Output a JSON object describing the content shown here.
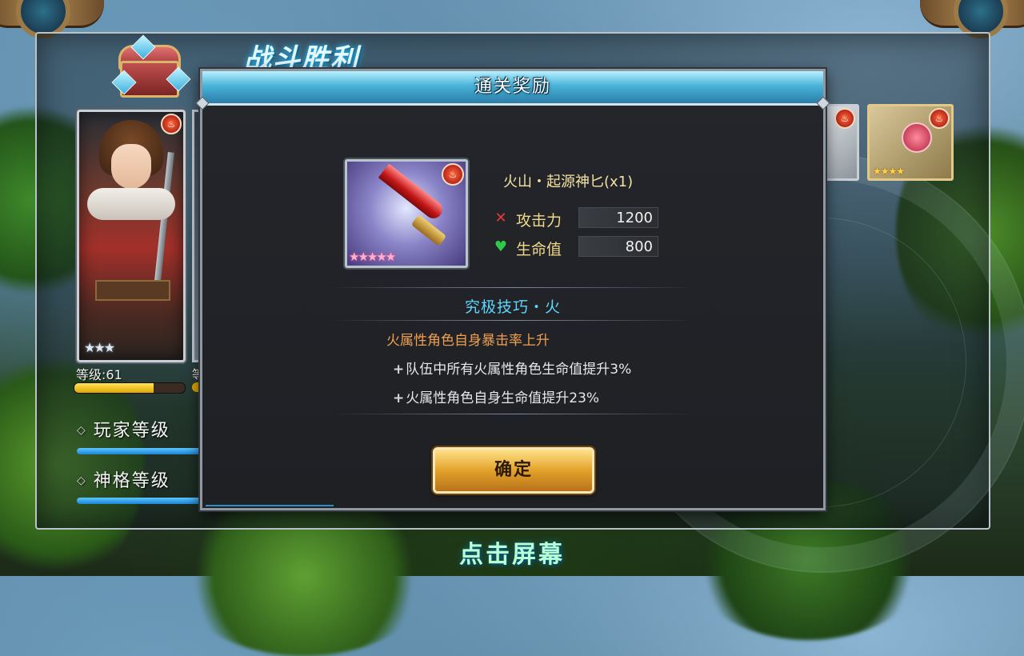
{
  "battle": {
    "title": "战斗胜利",
    "tap_hint": "点击屏幕"
  },
  "hero": {
    "level_label": "等级:61",
    "level_label_second": "等",
    "stars": "★★★",
    "element_icon": "fire-icon",
    "xp_progress": 0.72
  },
  "progress": {
    "player_level_label": "玩家等级",
    "god_level_label": "神格等级"
  },
  "right_items": [
    {
      "name": "item-partial",
      "element_icon": "fire-icon"
    },
    {
      "name": "rose-scepter",
      "element_icon": "fire-icon",
      "stars": "★★★★"
    }
  ],
  "dialog": {
    "title": "通关奖励",
    "item": {
      "name": "火山・起源神匕(x1)",
      "stars": "★★★★★",
      "element_icon": "fire-icon",
      "stats": [
        {
          "icon": "crossed-swords-icon",
          "label": "攻击力",
          "value": "1200"
        },
        {
          "icon": "heart-icon",
          "label": "生命值",
          "value": "800"
        }
      ]
    },
    "skill": {
      "title": "究极技巧・火",
      "description": "火属性角色自身暴击率上升",
      "effects": [
        "队伍中所有火属性角色生命值提升3%",
        "火属性角色自身生命值提升23%"
      ]
    },
    "confirm_label": "确定"
  },
  "colors": {
    "title_glow": "#2bc3ff",
    "button_gold": "#e3a22a",
    "skill_title": "#5fd6ff",
    "skill_desc": "#f0a050"
  }
}
